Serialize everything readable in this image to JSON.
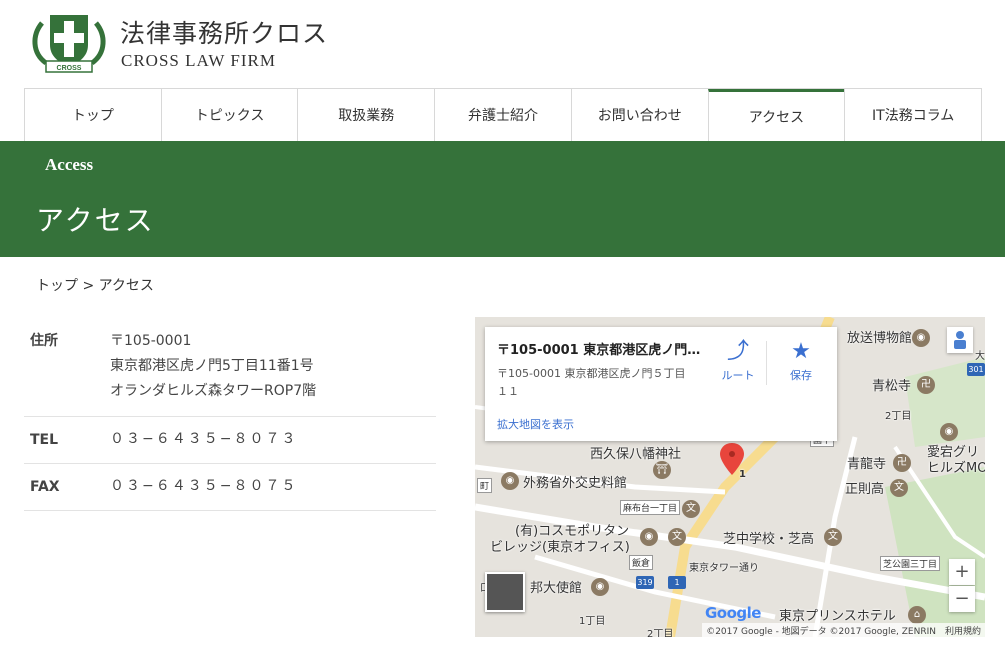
{
  "header": {
    "brand_jp": "法律事務所クロス",
    "brand_en": "CROSS LAW FIRM",
    "logo_text": "CROSS",
    "brand_color": "#35723a"
  },
  "nav": {
    "items": [
      {
        "label": "トップ"
      },
      {
        "label": "トピックス"
      },
      {
        "label": "取扱業務"
      },
      {
        "label": "弁護士紹介"
      },
      {
        "label": "お問い合わせ"
      },
      {
        "label": "アクセス",
        "active": true
      },
      {
        "label": "IT法務コラム"
      }
    ]
  },
  "banner": {
    "en": "Access",
    "jp": "アクセス"
  },
  "breadcrumb": {
    "text": "トップ > アクセス"
  },
  "info": {
    "address_label": "住所",
    "address_lines": [
      "〒105-0001",
      "東京都港区虎ノ門5丁目11番1号",
      "オランダヒルズ森タワーROP7階"
    ],
    "tel_label": "TEL",
    "tel_value": "０３−６４３５−８０７３",
    "fax_label": "FAX",
    "fax_value": "０３−６４３５−８０７５"
  },
  "map": {
    "card_title": "〒105-0001 東京都港区虎ノ門...",
    "card_address_1": "〒105-0001 東京都港区虎ノ門５丁目",
    "card_address_2": "１１",
    "enlarge_link": "拡大地図を表示",
    "route_label": "ルート",
    "save_label": "保存",
    "zoom_in": "+",
    "zoom_out": "−",
    "pin_label": "1",
    "labels": {
      "museum": "放送博物館",
      "seishoji": "青松寺",
      "nichome": "2丁目",
      "atago": "愛宕グリ",
      "hills": "ヒルズMO",
      "nishikubo": "西久保八幡神社",
      "seiryuji": "青龍寺",
      "gaimusho": "外務省外交史料館",
      "shosoku": "正則高",
      "azabu_sign": "麻布台一丁目",
      "cosmo1": "(有)コスモポリタン",
      "cosmo2": "ビレッジ(東京オフィス)",
      "shibachu": "芝中学校・芝高",
      "iikura": "飯倉",
      "tower_dori": "東京タワー通り",
      "shibakoen_sign": "芝公園三丁目",
      "embassy": "邦大使館",
      "prince": "東京プリンスホテル",
      "chome1": "1丁目",
      "chome2": "2丁目",
      "sign_left": "町",
      "sign_mid": "園下",
      "shield_319": "319",
      "shield_1": "1",
      "shield_301": "301",
      "edge_char": "大",
      "kuchi": "口"
    },
    "google_logo": "Google",
    "attribution": "©2017 Google - 地図データ ©2017 Google, ZENRIN　利用規約"
  }
}
